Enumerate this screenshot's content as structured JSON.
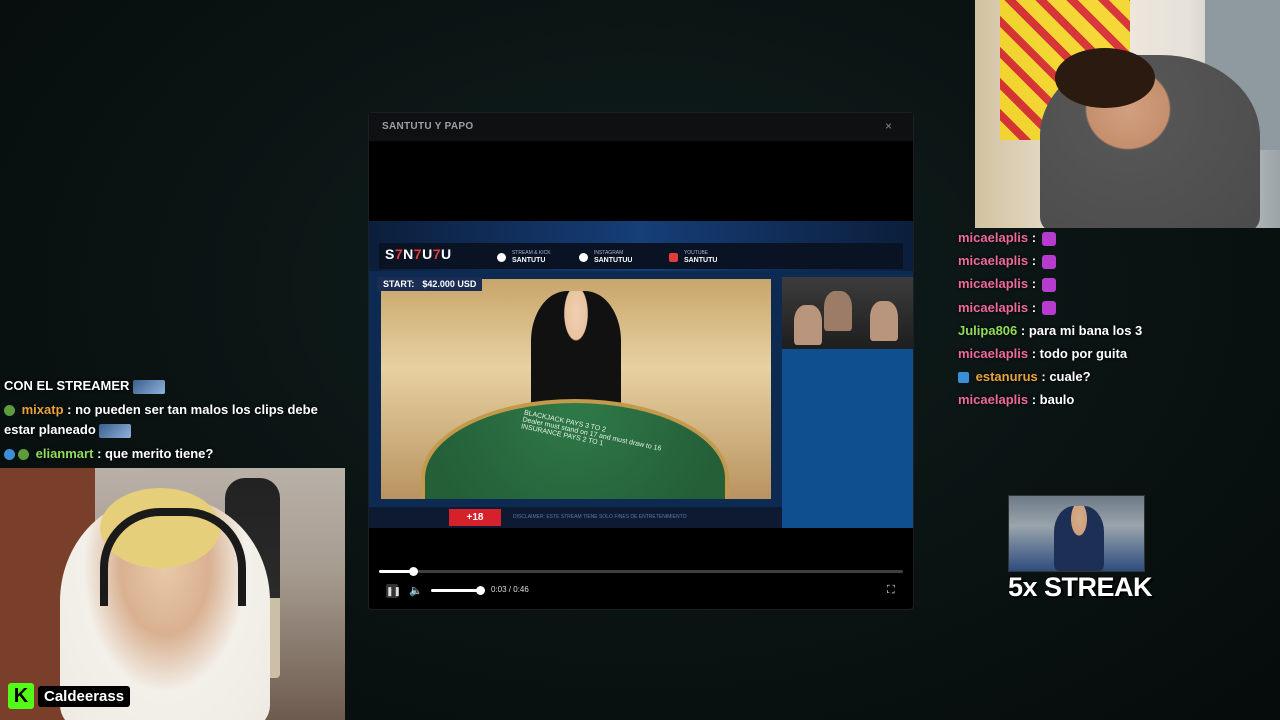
{
  "modal": {
    "title": "SANTUTU Y PAPO",
    "close_icon": "×",
    "video": {
      "brand": "S7N7U7U",
      "socials": [
        {
          "network": "x",
          "label": "SANTUTU",
          "caption": "STREAM & KICK"
        },
        {
          "network": "instagram",
          "label": "SANTUTUU",
          "caption": "INSTAGRAM"
        },
        {
          "network": "youtube",
          "label": "SANTUTU",
          "caption": "YOUTUBE"
        }
      ],
      "start_label": "START:",
      "start_amount": "$42.000 USD",
      "table_text_1": "BLACKJACK PAYS 3 TO 2",
      "table_text_2": "Dealer must stand on 17 and must draw to 16",
      "table_text_3": "INSURANCE PAYS 2 TO 1",
      "plus_badge": "+18",
      "disclaimer": "DISCLAIMER: ESTE STREAM TIENE SOLO FINES DE ENTRETENIMIENTO"
    },
    "player": {
      "progress_fraction": 0.065,
      "volume_fraction": 1.0,
      "time": "0:03 / 0:46"
    }
  },
  "chat_left": {
    "lines": [
      {
        "user": "",
        "message": "CON EL STREAMER"
      },
      {
        "user": "mixatp",
        "user_color": "#e8a33d",
        "message": ": no pueden ser tan malos los clips debe estar planeado"
      },
      {
        "user": "elianmart",
        "user_color": "#8fdc5a",
        "message": ": que merito tiene?"
      }
    ]
  },
  "streamer_left": {
    "name": "Caldeerass"
  },
  "chat_right": {
    "lines": [
      {
        "user": "micaelaplis",
        "user_color": "#f0699a",
        "message": ":",
        "emote": true
      },
      {
        "user": "micaelaplis",
        "user_color": "#f0699a",
        "message": ":",
        "emote": true
      },
      {
        "user": "micaelaplis",
        "user_color": "#f0699a",
        "message": ":",
        "emote": true
      },
      {
        "user": "micaelaplis",
        "user_color": "#f0699a",
        "message": ":",
        "emote": true
      },
      {
        "user": "Julipa806",
        "user_color": "#8fdc5a",
        "message": ": para mi bana los 3"
      },
      {
        "user": "micaelaplis",
        "user_color": "#f0699a",
        "message": ": todo por guita"
      },
      {
        "user": "estanurus",
        "user_color": "#e8a33d",
        "message": ": cuale?"
      },
      {
        "user": "micaelaplis",
        "user_color": "#f0699a",
        "message": ": baulo"
      }
    ]
  },
  "streak": {
    "label": "5x STREAK"
  }
}
